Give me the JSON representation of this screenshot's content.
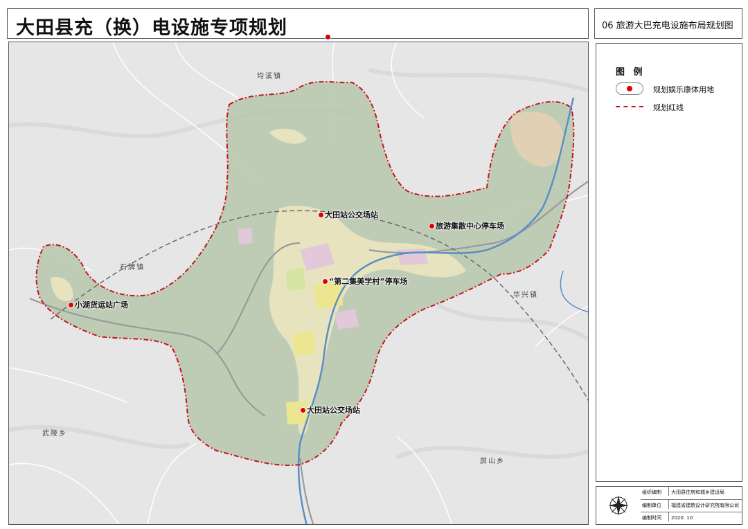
{
  "header": {
    "title": "大田县充（换）电设施专项规划",
    "sheet_title": "06 旅游大巴充电设施布局规划图"
  },
  "legend": {
    "heading": "图 例",
    "items": [
      {
        "label": "规划娱乐康体用地",
        "symbol": "red-dot-marker"
      },
      {
        "label": "规划红线",
        "symbol": "red-dash-dot-line"
      }
    ]
  },
  "colors": {
    "boundary": "#c4141d",
    "planning_area": "#b6c7ad",
    "marker": "#e00000",
    "river": "#5a8fc4"
  },
  "map": {
    "towns": [
      "均溪镇",
      "石牌镇",
      "华兴镇",
      "武陵乡",
      "屏山乡"
    ],
    "sites": [
      {
        "label": "大田站公交场站"
      },
      {
        "label": "旅游集散中心停车场"
      },
      {
        "label": "“第二集美学村”停车场"
      },
      {
        "label": "小湖货运站广场"
      },
      {
        "label": "大田站公交场站"
      }
    ]
  },
  "info": {
    "rows": [
      {
        "key": "组织编制",
        "value": "大田县住房和城乡建设局"
      },
      {
        "key": "编制单位",
        "value": "福建省建筑设计研究院有限公司"
      },
      {
        "key": "编制时间",
        "value": "2020. 10"
      }
    ]
  }
}
